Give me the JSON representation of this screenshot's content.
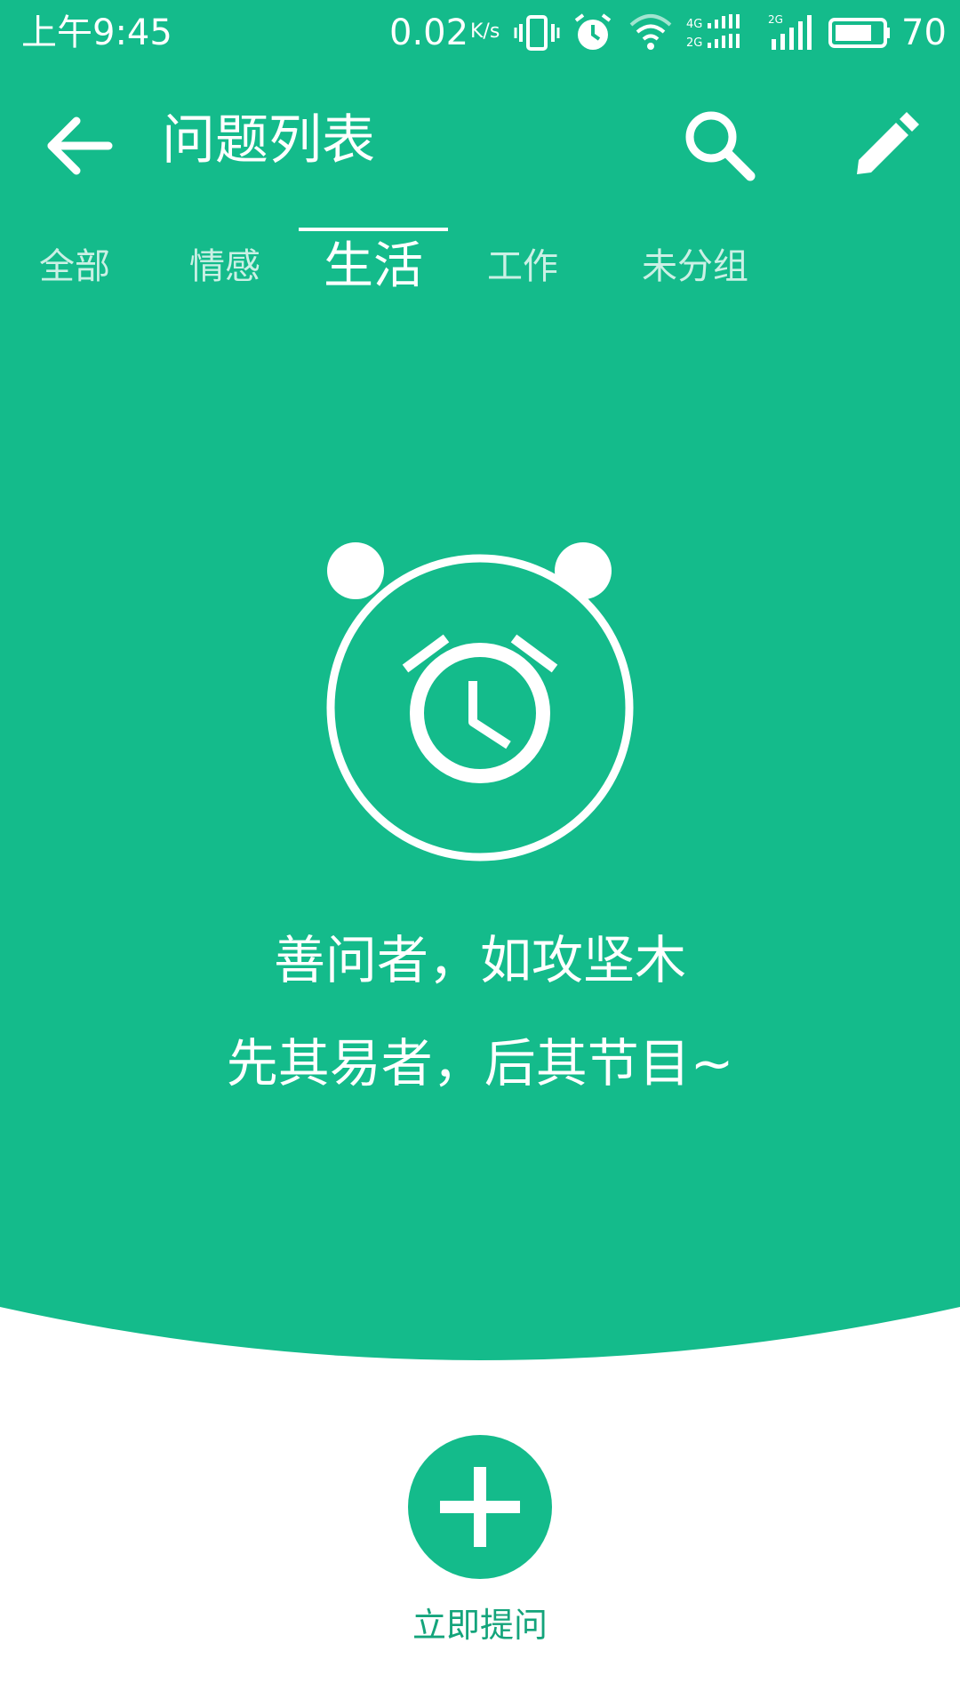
{
  "status_bar": {
    "time": "上午9:45",
    "net_speed": "0.02",
    "net_speed_unit": "K/s",
    "battery": "70",
    "icons": [
      "vibrate-icon",
      "alarm-icon",
      "wifi-icon",
      "signal-4g-2g-icon",
      "signal-2g-icon",
      "battery-icon"
    ]
  },
  "app_bar": {
    "title": "问题列表",
    "back_icon": "arrow-left-icon",
    "search_icon": "search-icon",
    "edit_icon": "pencil-icon"
  },
  "tabs": [
    {
      "label": "全部",
      "active": false
    },
    {
      "label": "情感",
      "active": false
    },
    {
      "label": "生活",
      "active": true
    },
    {
      "label": "工作",
      "active": false
    },
    {
      "label": "未分组",
      "active": false
    }
  ],
  "empty_state": {
    "icon": "alarm-clock-icon",
    "line1": "善问者，如攻坚木",
    "line2": "先其易者，后其节目~"
  },
  "fab": {
    "icon": "plus-icon",
    "label": "立即提问"
  },
  "colors": {
    "primary": "#14BB8B",
    "on_primary": "#FFFFFF",
    "background": "#FFFFFF"
  }
}
